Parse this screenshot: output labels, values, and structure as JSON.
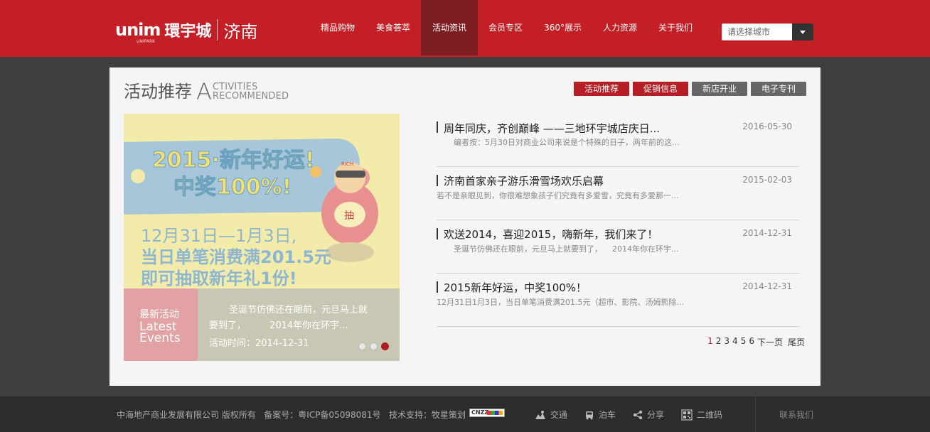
{
  "header": {
    "logo_en": "unim",
    "logo_en_sub": "UNIPARK",
    "logo_cn": "環宇城",
    "logo_city": "济南",
    "nav": [
      {
        "label": "精品购物",
        "active": false
      },
      {
        "label": "美食荟萃",
        "active": false
      },
      {
        "label": "活动资讯",
        "active": true
      },
      {
        "label": "会员专区",
        "active": false
      },
      {
        "label": "360°展示",
        "active": false
      },
      {
        "label": "人力资源",
        "active": false
      },
      {
        "label": "关于我们",
        "active": false
      }
    ],
    "city_select": "请选择城市"
  },
  "section": {
    "title_cn": "活动推荐",
    "title_letter": "A",
    "title_en_1": "CTIVITIES",
    "title_en_2": "RECOMMENDED",
    "tabs": [
      "活动推荐",
      "促销信息",
      "新店开业",
      "电子专刊"
    ]
  },
  "slider": {
    "poster_line1": "2015·新年好运!",
    "poster_line2": "中奖100%!",
    "poster_line3": "12月31日—1月3日,",
    "poster_line4": "当日单笔消费满201.5元",
    "poster_line5": "即可抽取新年礼1份!",
    "poster_badge": "抽",
    "poster_mascot": "RICH",
    "side_cn": "最新活动",
    "side_en_1": "Latest",
    "side_en_2": "Events",
    "text_1": "圣诞节仿佛还在眼前，元旦马上就",
    "text_2": "要到了，",
    "text_3": "2014年你在环宇...",
    "date": "活动时间：2014-12-31"
  },
  "news": [
    {
      "title": "周年同庆，齐创巅峰 ——三地环宇城店庆日...",
      "date": "2016-05-30",
      "desc": "编者按：5月30日对商业公司来说是个特殊的日子，两年前的这...",
      "indent": true
    },
    {
      "title": "济南首家亲子游乐滑雪场欢乐启幕",
      "date": "2015-02-03",
      "desc": "若不是亲眼见到，你很难想象孩子们究竟有多爱雪，究竟有多爱那一...",
      "indent": false
    },
    {
      "title": "欢送2014，喜迎2015，嗨新年，我们来了！",
      "date": "2014-12-31",
      "desc": "圣诞节仿佛还在眼前，元旦马上就要到了，    2014年你在环宇...",
      "indent": true
    },
    {
      "title": "2015新年好运，中奖100%！",
      "date": "2014-12-31",
      "desc": "12月31日1月3日，当日单笔消费满201.5元（超市、影院、汤姆熊除...",
      "indent": false
    }
  ],
  "pager": {
    "pages": [
      "1",
      "2",
      "3",
      "4",
      "5",
      "6"
    ],
    "next": "下一页",
    "last": "尾页"
  },
  "footer": {
    "copyright": "中海地产商业发展有限公司 版权所有",
    "icp": "备案号：粤ICP备05098081号",
    "support": "技术支持：牧星策划",
    "cnzz": "CNZZ",
    "tools": [
      "交通",
      "泊车",
      "分享",
      "二维码"
    ],
    "contact": "联系我们"
  },
  "colors": {
    "brand_red": "#c41f26",
    "nav_active": "#7d1e22",
    "tab_red": "#b51e24",
    "tab_gray": "#666666",
    "footer_bg": "#2c2c2c"
  }
}
